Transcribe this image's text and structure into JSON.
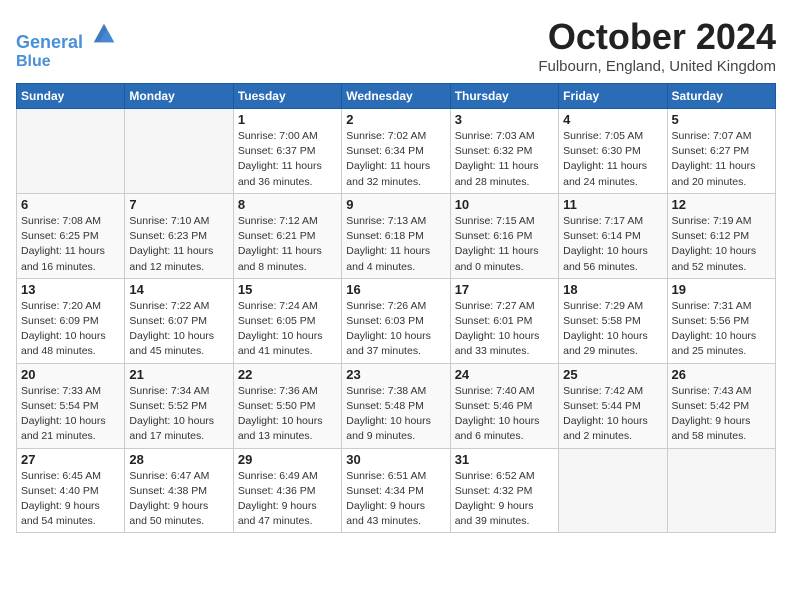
{
  "header": {
    "logo_line1": "General",
    "logo_line2": "Blue",
    "month": "October 2024",
    "location": "Fulbourn, England, United Kingdom"
  },
  "weekdays": [
    "Sunday",
    "Monday",
    "Tuesday",
    "Wednesday",
    "Thursday",
    "Friday",
    "Saturday"
  ],
  "weeks": [
    [
      {
        "day": "",
        "info": ""
      },
      {
        "day": "",
        "info": ""
      },
      {
        "day": "1",
        "info": "Sunrise: 7:00 AM\nSunset: 6:37 PM\nDaylight: 11 hours\nand 36 minutes."
      },
      {
        "day": "2",
        "info": "Sunrise: 7:02 AM\nSunset: 6:34 PM\nDaylight: 11 hours\nand 32 minutes."
      },
      {
        "day": "3",
        "info": "Sunrise: 7:03 AM\nSunset: 6:32 PM\nDaylight: 11 hours\nand 28 minutes."
      },
      {
        "day": "4",
        "info": "Sunrise: 7:05 AM\nSunset: 6:30 PM\nDaylight: 11 hours\nand 24 minutes."
      },
      {
        "day": "5",
        "info": "Sunrise: 7:07 AM\nSunset: 6:27 PM\nDaylight: 11 hours\nand 20 minutes."
      }
    ],
    [
      {
        "day": "6",
        "info": "Sunrise: 7:08 AM\nSunset: 6:25 PM\nDaylight: 11 hours\nand 16 minutes."
      },
      {
        "day": "7",
        "info": "Sunrise: 7:10 AM\nSunset: 6:23 PM\nDaylight: 11 hours\nand 12 minutes."
      },
      {
        "day": "8",
        "info": "Sunrise: 7:12 AM\nSunset: 6:21 PM\nDaylight: 11 hours\nand 8 minutes."
      },
      {
        "day": "9",
        "info": "Sunrise: 7:13 AM\nSunset: 6:18 PM\nDaylight: 11 hours\nand 4 minutes."
      },
      {
        "day": "10",
        "info": "Sunrise: 7:15 AM\nSunset: 6:16 PM\nDaylight: 11 hours\nand 0 minutes."
      },
      {
        "day": "11",
        "info": "Sunrise: 7:17 AM\nSunset: 6:14 PM\nDaylight: 10 hours\nand 56 minutes."
      },
      {
        "day": "12",
        "info": "Sunrise: 7:19 AM\nSunset: 6:12 PM\nDaylight: 10 hours\nand 52 minutes."
      }
    ],
    [
      {
        "day": "13",
        "info": "Sunrise: 7:20 AM\nSunset: 6:09 PM\nDaylight: 10 hours\nand 48 minutes."
      },
      {
        "day": "14",
        "info": "Sunrise: 7:22 AM\nSunset: 6:07 PM\nDaylight: 10 hours\nand 45 minutes."
      },
      {
        "day": "15",
        "info": "Sunrise: 7:24 AM\nSunset: 6:05 PM\nDaylight: 10 hours\nand 41 minutes."
      },
      {
        "day": "16",
        "info": "Sunrise: 7:26 AM\nSunset: 6:03 PM\nDaylight: 10 hours\nand 37 minutes."
      },
      {
        "day": "17",
        "info": "Sunrise: 7:27 AM\nSunset: 6:01 PM\nDaylight: 10 hours\nand 33 minutes."
      },
      {
        "day": "18",
        "info": "Sunrise: 7:29 AM\nSunset: 5:58 PM\nDaylight: 10 hours\nand 29 minutes."
      },
      {
        "day": "19",
        "info": "Sunrise: 7:31 AM\nSunset: 5:56 PM\nDaylight: 10 hours\nand 25 minutes."
      }
    ],
    [
      {
        "day": "20",
        "info": "Sunrise: 7:33 AM\nSunset: 5:54 PM\nDaylight: 10 hours\nand 21 minutes."
      },
      {
        "day": "21",
        "info": "Sunrise: 7:34 AM\nSunset: 5:52 PM\nDaylight: 10 hours\nand 17 minutes."
      },
      {
        "day": "22",
        "info": "Sunrise: 7:36 AM\nSunset: 5:50 PM\nDaylight: 10 hours\nand 13 minutes."
      },
      {
        "day": "23",
        "info": "Sunrise: 7:38 AM\nSunset: 5:48 PM\nDaylight: 10 hours\nand 9 minutes."
      },
      {
        "day": "24",
        "info": "Sunrise: 7:40 AM\nSunset: 5:46 PM\nDaylight: 10 hours\nand 6 minutes."
      },
      {
        "day": "25",
        "info": "Sunrise: 7:42 AM\nSunset: 5:44 PM\nDaylight: 10 hours\nand 2 minutes."
      },
      {
        "day": "26",
        "info": "Sunrise: 7:43 AM\nSunset: 5:42 PM\nDaylight: 9 hours\nand 58 minutes."
      }
    ],
    [
      {
        "day": "27",
        "info": "Sunrise: 6:45 AM\nSunset: 4:40 PM\nDaylight: 9 hours\nand 54 minutes."
      },
      {
        "day": "28",
        "info": "Sunrise: 6:47 AM\nSunset: 4:38 PM\nDaylight: 9 hours\nand 50 minutes."
      },
      {
        "day": "29",
        "info": "Sunrise: 6:49 AM\nSunset: 4:36 PM\nDaylight: 9 hours\nand 47 minutes."
      },
      {
        "day": "30",
        "info": "Sunrise: 6:51 AM\nSunset: 4:34 PM\nDaylight: 9 hours\nand 43 minutes."
      },
      {
        "day": "31",
        "info": "Sunrise: 6:52 AM\nSunset: 4:32 PM\nDaylight: 9 hours\nand 39 minutes."
      },
      {
        "day": "",
        "info": ""
      },
      {
        "day": "",
        "info": ""
      }
    ]
  ]
}
